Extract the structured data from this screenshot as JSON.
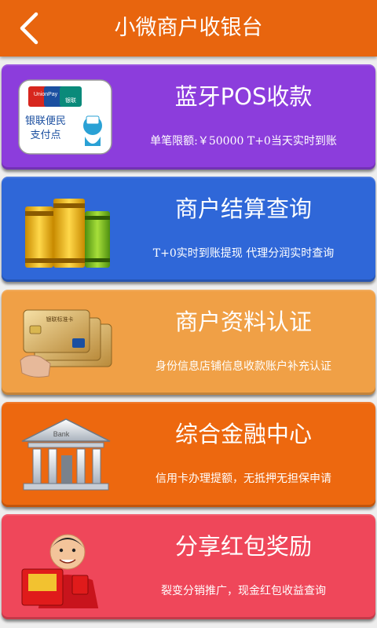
{
  "header": {
    "title": "小微商户收银台"
  },
  "cards": [
    {
      "title": "蓝牙POS收款",
      "subtitle": "单笔限额:￥50000  T+0当天实时到账",
      "icon": "unionpay-icon",
      "color": "#8c3ddc",
      "logo_text": [
        "UnionPay",
        "银联",
        "银联便民",
        "支付点"
      ]
    },
    {
      "title": "商户结算查询",
      "subtitle": "T+0实时到账提现 代理分润实时查询",
      "icon": "books-icon",
      "color": "#2f67d8"
    },
    {
      "title": "商户资料认证",
      "subtitle": "身份信息店铺信息收款账户补充认证",
      "icon": "bank-cards-icon",
      "color": "#f0a046",
      "logo_text": [
        "银联标准卡"
      ]
    },
    {
      "title": "综合金融中心",
      "subtitle": "信用卡办理提额，无抵押无担保申请",
      "icon": "bank-building-icon",
      "color": "#ed680f",
      "logo_text": [
        "Bank"
      ]
    },
    {
      "title": "分享红包奖励",
      "subtitle": "裂变分销推广，现金红包收益查询",
      "icon": "red-envelope-boy-icon",
      "color": "#ef475a"
    }
  ]
}
